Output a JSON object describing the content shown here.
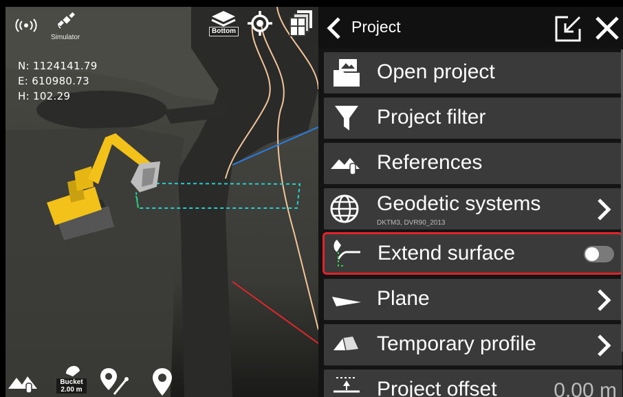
{
  "status": {
    "signal_icon": "radio-signal-icon",
    "satellite_icon": "satellite-icon",
    "simulator_label": "Simulator"
  },
  "coords": {
    "north": "N: 1124141.79",
    "east": "E: 610980.73",
    "height": "H: 102.29"
  },
  "map_toolbar": {
    "layers_icon": "layers-icon",
    "view_label": "Bottom",
    "center_icon": "crosshair-icon",
    "windows_icon": "windows-icon"
  },
  "bottom_bar": {
    "references_icon": "references-icon",
    "bucket_label": "Bucket",
    "bucket_value": "2.00 m",
    "route_icon": "route-icon",
    "pin_icon": "location-pin-icon"
  },
  "panel": {
    "back_icon": "chevron-left-icon",
    "title": "Project",
    "undock_icon": "undock-icon",
    "close_icon": "close-icon",
    "items": [
      {
        "label": "Open project",
        "icon": "folder-image-icon"
      },
      {
        "label": "Project filter",
        "icon": "filter-icon"
      },
      {
        "label": "References",
        "icon": "references-icon"
      },
      {
        "label": "Geodetic systems",
        "sublabel": "DKTM3, DVR90_2013",
        "icon": "globe-icon"
      },
      {
        "label": "Extend surface",
        "icon": "extend-surface-icon",
        "toggle": false
      },
      {
        "label": "Plane",
        "icon": "plane-icon"
      },
      {
        "label": "Temporary profile",
        "icon": "temporary-profile-icon"
      },
      {
        "label": "Project offset",
        "value": "0.00 m",
        "icon": "offset-icon"
      }
    ]
  },
  "colors": {
    "accent_selected": "#e0242b",
    "row_bg": "#3a3a3a",
    "excavator": "#f2c21a"
  }
}
